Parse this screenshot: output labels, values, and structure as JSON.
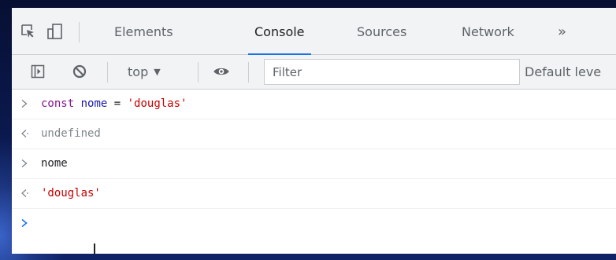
{
  "colors": {
    "accent": "#1a73e8",
    "keyword": "#881391",
    "variable": "#1a1aa6",
    "string": "#c80000",
    "undefined": "#80868b"
  },
  "tabbar": {
    "icons": [
      "inspect-element-icon",
      "device-toolbar-icon",
      "more-tabs-icon"
    ],
    "tabs": [
      {
        "label": "Elements",
        "active": false
      },
      {
        "label": "Console",
        "active": true
      },
      {
        "label": "Sources",
        "active": false
      },
      {
        "label": "Network",
        "active": false
      }
    ],
    "more_label": "»"
  },
  "toolbar": {
    "icons": [
      "sidebar-toggle-icon",
      "clear-console-icon",
      "live-expression-eye-icon"
    ],
    "context": "top",
    "filter_placeholder": "Filter",
    "levels_label": "Default leve"
  },
  "console": {
    "lines": [
      {
        "kind": "input",
        "tokens": [
          {
            "text": "const",
            "type": "keyword"
          },
          {
            "text": " ",
            "type": "plain"
          },
          {
            "text": "nome",
            "type": "variable"
          },
          {
            "text": " = ",
            "type": "operator"
          },
          {
            "text": "'douglas'",
            "type": "string"
          }
        ]
      },
      {
        "kind": "output",
        "tokens": [
          {
            "text": "undefined",
            "type": "undefined"
          }
        ]
      },
      {
        "kind": "input",
        "tokens": [
          {
            "text": "nome",
            "type": "plain"
          }
        ]
      },
      {
        "kind": "output",
        "tokens": [
          {
            "text": "'douglas'",
            "type": "string"
          }
        ]
      }
    ],
    "prompt_value": ""
  }
}
